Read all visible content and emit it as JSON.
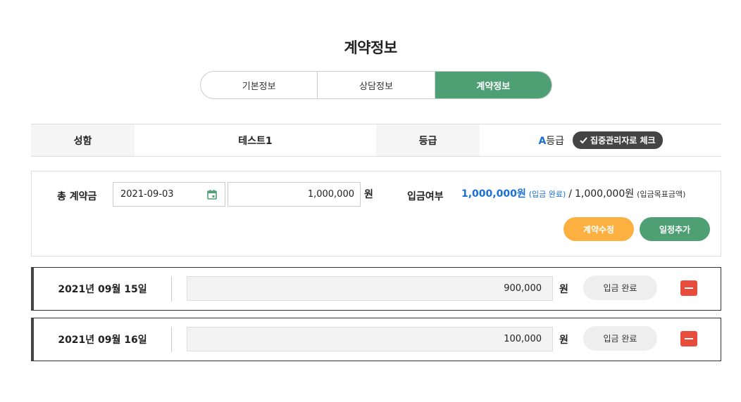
{
  "page": {
    "title": "계약정보"
  },
  "tabs": [
    {
      "label": "기본정보"
    },
    {
      "label": "상담정보"
    },
    {
      "label": "계약정보"
    }
  ],
  "info": {
    "name_label": "성함",
    "name_value": "테스트1",
    "grade_label": "등급",
    "grade_letter": "A",
    "grade_suffix": "등급",
    "check_badge": "집중관리자로 체크"
  },
  "contract": {
    "label": "총 계약금",
    "date": "2021-09-03",
    "amount": "1,000,000",
    "currency": "원",
    "deposit_label": "입금여부",
    "deposit_amount": "1,000,000원",
    "deposit_status": "(입금 완료)",
    "separator": "/",
    "target_amount": "1,000,000원",
    "target_label": "(입금목표금액)",
    "edit_button": "계약수정",
    "add_button": "일정추가"
  },
  "schedules": [
    {
      "date": "2021년 09월 15일",
      "amount": "900,000",
      "currency": "원",
      "status": "입금 완료"
    },
    {
      "date": "2021년 09월 16일",
      "amount": "100,000",
      "currency": "원",
      "status": "입금 완료"
    }
  ],
  "colors": {
    "accent": "#4f9f74",
    "blue": "#1a6fd6",
    "orange": "#fbb040",
    "red": "#e84c3d"
  }
}
